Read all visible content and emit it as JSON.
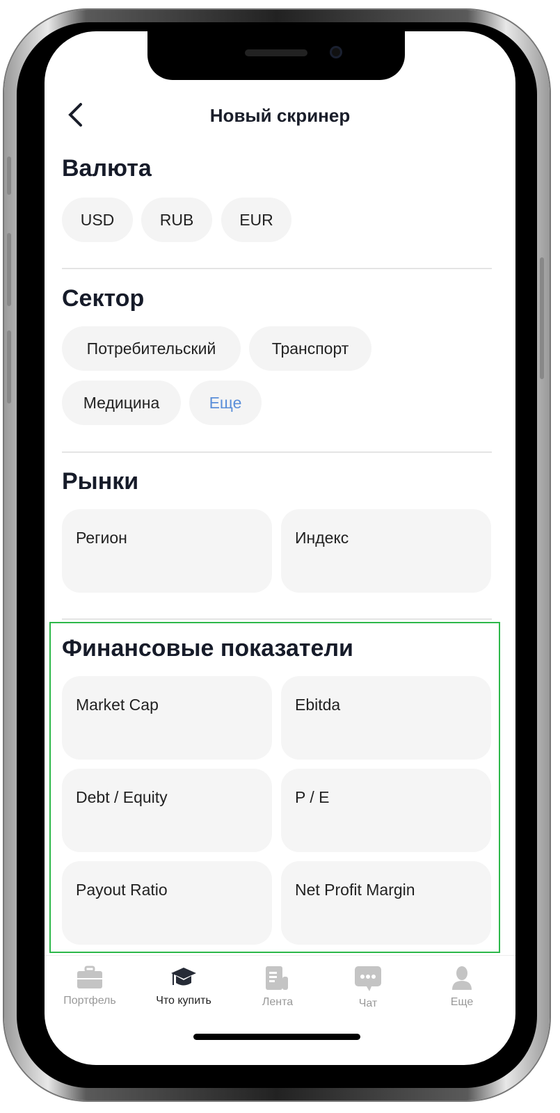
{
  "header": {
    "back_icon": "chevron-left-icon",
    "title": "Новый скринер"
  },
  "currency": {
    "title": "Валюта",
    "options": [
      "USD",
      "RUB",
      "EUR"
    ]
  },
  "sector": {
    "title": "Сектор",
    "options": [
      "Потребительский",
      "Транспорт",
      "Медицина"
    ],
    "more": "Еще",
    "more_color": "#5b8fd9"
  },
  "markets": {
    "title": "Рынки",
    "cards": [
      "Регион",
      "Индекс"
    ]
  },
  "financials": {
    "title": "Финансовые показатели",
    "cards": [
      "Market Cap",
      "Ebitda",
      "Debt / Equity",
      "P / E",
      "Payout Ratio",
      "Net Profit Margin"
    ],
    "highlight_color": "#2db84a"
  },
  "tabbar": {
    "active": "Что купить",
    "items": [
      {
        "label": "Портфель",
        "icon": "briefcase-icon"
      },
      {
        "label": "Что купить",
        "icon": "graduation-cap-icon"
      },
      {
        "label": "Лента",
        "icon": "news-icon"
      },
      {
        "label": "Чат",
        "icon": "chat-icon"
      },
      {
        "label": "Еще",
        "icon": "user-icon"
      }
    ]
  }
}
